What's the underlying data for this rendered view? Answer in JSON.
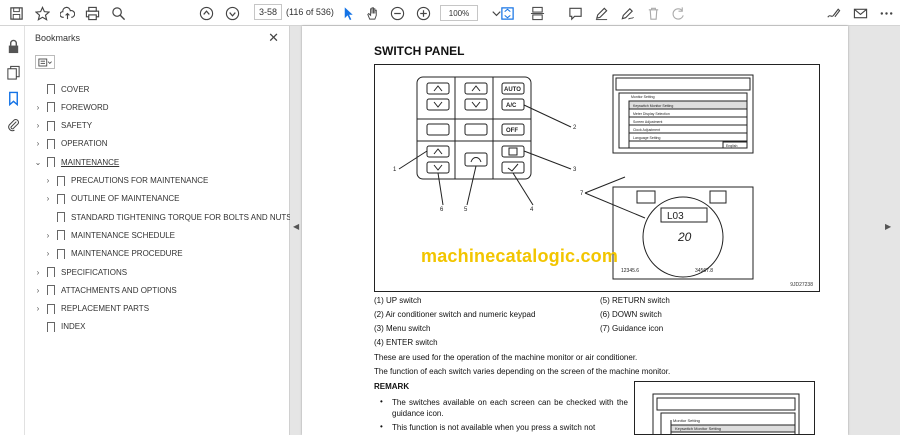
{
  "toolbar": {
    "page_current": "3-58",
    "page_count": "(116 of 536)",
    "zoom": "100%"
  },
  "bookmarks": {
    "title": "Bookmarks",
    "items": [
      {
        "label": "COVER",
        "expandable": false,
        "expanded": false,
        "level": 0
      },
      {
        "label": "FOREWORD",
        "expandable": true,
        "expanded": false,
        "level": 0
      },
      {
        "label": "SAFETY",
        "expandable": true,
        "expanded": false,
        "level": 0
      },
      {
        "label": "OPERATION",
        "expandable": true,
        "expanded": false,
        "level": 0
      },
      {
        "label": "MAINTENANCE",
        "expandable": true,
        "expanded": true,
        "level": 0,
        "current": true
      },
      {
        "label": "PRECAUTIONS FOR MAINTENANCE",
        "expandable": true,
        "expanded": false,
        "level": 1
      },
      {
        "label": "OUTLINE OF MAINTENANCE",
        "expandable": true,
        "expanded": false,
        "level": 1
      },
      {
        "label": "STANDARD TIGHTENING TORQUE FOR BOLTS AND NUTS",
        "expandable": false,
        "expanded": false,
        "level": 1
      },
      {
        "label": "MAINTENANCE SCHEDULE",
        "expandable": true,
        "expanded": false,
        "level": 1
      },
      {
        "label": "MAINTENANCE PROCEDURE",
        "expandable": true,
        "expanded": false,
        "level": 1
      },
      {
        "label": "SPECIFICATIONS",
        "expandable": true,
        "expanded": false,
        "level": 0
      },
      {
        "label": "ATTACHMENTS AND OPTIONS",
        "expandable": true,
        "expanded": false,
        "level": 0
      },
      {
        "label": "REPLACEMENT PARTS",
        "expandable": true,
        "expanded": false,
        "level": 0
      },
      {
        "label": "INDEX",
        "expandable": false,
        "expanded": false,
        "level": 0
      }
    ]
  },
  "document": {
    "heading": "SWITCH PANEL",
    "figure_id": "9JD27238",
    "watermark": "machinecatalogic.com",
    "figure": {
      "keys": {
        "auto": "AUTO",
        "ac": "A/C",
        "off": "OFF"
      },
      "callouts": [
        "1",
        "2",
        "3",
        "4",
        "5",
        "6",
        "7"
      ],
      "monitor_menu": {
        "title": "Monitor Setting",
        "items": [
          "Breaker/Attachment Setting",
          "Meter Display Selection",
          "Screen Adjustment",
          "Clock Adjustment",
          "Language Setting"
        ],
        "highlight": "Keyswitch Monitor Setting",
        "extra": "English"
      },
      "gauge": {
        "mode": "L03",
        "value": "20",
        "hours_left": "12345.6",
        "hours_right": "34567.8"
      }
    },
    "captions": [
      "(1) UP switch",
      "(2) Air conditioner switch and numeric keypad",
      "(3) Menu switch",
      "(4) ENTER switch",
      "(5) RETURN switch",
      "(6) DOWN switch",
      "(7) Guidance icon"
    ],
    "para1": "These are used for the operation of the machine monitor or air conditioner.",
    "para2": "The function of each switch varies depending on the screen of the machine monitor.",
    "remark": "REMARK",
    "bullets": [
      "The switches available on each screen can be checked with the guidance icon.",
      "This function is not available when you press a switch not"
    ],
    "mini_menu": {
      "title": "Monitor Setting",
      "highlight": "Keyswitch Monitor Setting"
    }
  }
}
